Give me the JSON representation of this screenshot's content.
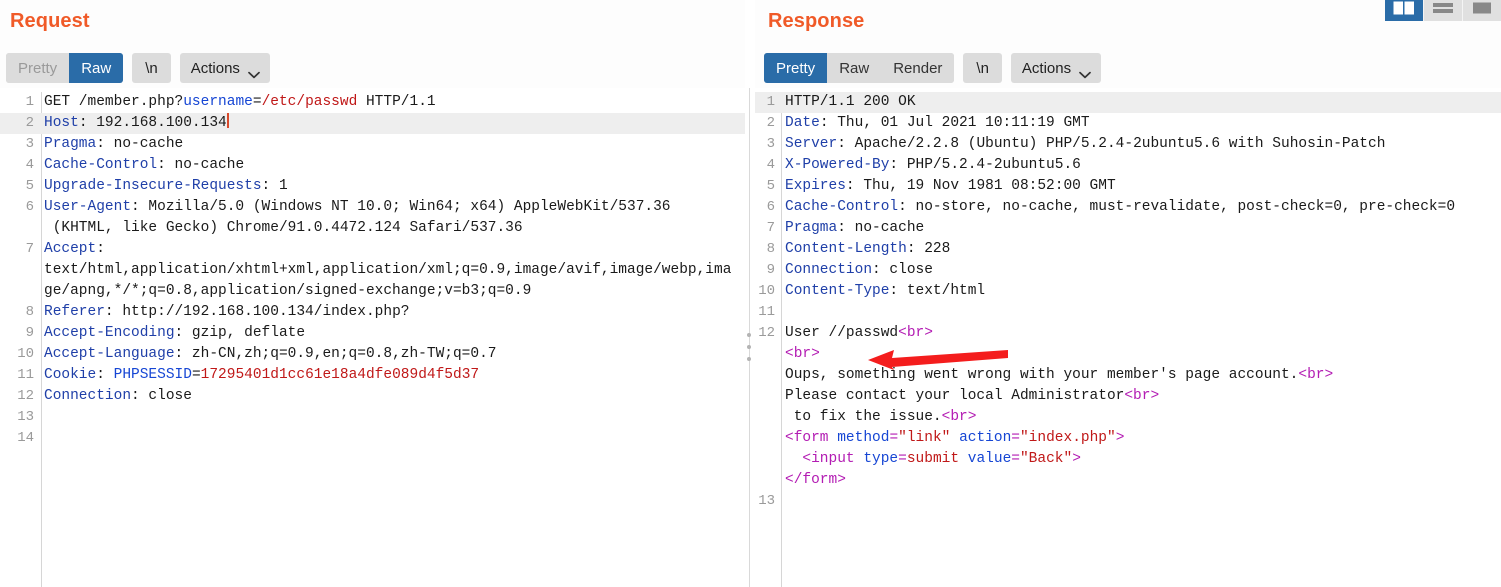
{
  "layout_toggles": [
    {
      "name": "side-by-side-layout",
      "label": "",
      "active": true
    },
    {
      "name": "stacked-layout",
      "label": "",
      "active": false
    },
    {
      "name": "single-pane-layout",
      "label": "",
      "active": false
    }
  ],
  "request": {
    "title": "Request",
    "toolbar": {
      "pretty": "Pretty",
      "raw": "Raw",
      "newline": "\\n",
      "actions": "Actions",
      "active_view": "Raw"
    },
    "lines": [
      {
        "n": "1",
        "highlight": false,
        "segs": [
          {
            "t": "GET /member.php?",
            "c": "k-txt"
          },
          {
            "t": "username",
            "c": "k-key"
          },
          {
            "t": "=",
            "c": "k-txt"
          },
          {
            "t": "/etc/passwd",
            "c": "k-val"
          },
          {
            "t": " HTTP/1.1",
            "c": "k-txt"
          }
        ]
      },
      {
        "n": "2",
        "highlight": true,
        "caret": true,
        "segs": [
          {
            "t": "Host",
            "c": "k-hdr"
          },
          {
            "t": ": 192.168.100.134",
            "c": "k-txt"
          }
        ]
      },
      {
        "n": "3",
        "highlight": false,
        "segs": [
          {
            "t": "Pragma",
            "c": "k-hdr"
          },
          {
            "t": ": no-cache",
            "c": "k-txt"
          }
        ]
      },
      {
        "n": "4",
        "highlight": false,
        "segs": [
          {
            "t": "Cache-Control",
            "c": "k-hdr"
          },
          {
            "t": ": no-cache",
            "c": "k-txt"
          }
        ]
      },
      {
        "n": "5",
        "highlight": false,
        "segs": [
          {
            "t": "Upgrade-Insecure-Requests",
            "c": "k-hdr"
          },
          {
            "t": ": 1",
            "c": "k-txt"
          }
        ]
      },
      {
        "n": "6",
        "highlight": false,
        "segs": [
          {
            "t": "User-Agent",
            "c": "k-hdr"
          },
          {
            "t": ": Mozilla/5.0 (Windows NT 10.0; Win64; x64) AppleWebKit/537.36",
            "c": "k-txt"
          }
        ]
      },
      {
        "n": "",
        "highlight": false,
        "segs": [
          {
            "t": " (KHTML, like Gecko) Chrome/91.0.4472.124 Safari/537.36",
            "c": "k-txt"
          }
        ]
      },
      {
        "n": "7",
        "highlight": false,
        "segs": [
          {
            "t": "Accept",
            "c": "k-hdr"
          },
          {
            "t": ":",
            "c": "k-txt"
          }
        ]
      },
      {
        "n": "",
        "highlight": false,
        "segs": [
          {
            "t": "text/html,application/xhtml+xml,application/xml;q=0.9,image/avif,image/webp,ima",
            "c": "k-txt"
          }
        ]
      },
      {
        "n": "",
        "highlight": false,
        "segs": [
          {
            "t": "ge/apng,*/*;q=0.8,application/signed-exchange;v=b3;q=0.9",
            "c": "k-txt"
          }
        ]
      },
      {
        "n": "8",
        "highlight": false,
        "segs": [
          {
            "t": "Referer",
            "c": "k-hdr"
          },
          {
            "t": ": http://192.168.100.134/index.php?",
            "c": "k-txt"
          }
        ]
      },
      {
        "n": "9",
        "highlight": false,
        "segs": [
          {
            "t": "Accept-Encoding",
            "c": "k-hdr"
          },
          {
            "t": ": gzip, deflate",
            "c": "k-txt"
          }
        ]
      },
      {
        "n": "10",
        "highlight": false,
        "segs": [
          {
            "t": "Accept-Language",
            "c": "k-hdr"
          },
          {
            "t": ": zh-CN,zh;q=0.9,en;q=0.8,zh-TW;q=0.7",
            "c": "k-txt"
          }
        ]
      },
      {
        "n": "11",
        "highlight": false,
        "segs": [
          {
            "t": "Cookie",
            "c": "k-hdr"
          },
          {
            "t": ": ",
            "c": "k-txt"
          },
          {
            "t": "PHPSESSID",
            "c": "k-key"
          },
          {
            "t": "=",
            "c": "k-txt"
          },
          {
            "t": "17295401d1cc61e18a4dfe089d4f5d37",
            "c": "k-val"
          }
        ]
      },
      {
        "n": "12",
        "highlight": false,
        "segs": [
          {
            "t": "Connection",
            "c": "k-hdr"
          },
          {
            "t": ": close",
            "c": "k-txt"
          }
        ]
      },
      {
        "n": "13",
        "highlight": false,
        "segs": []
      },
      {
        "n": "14",
        "highlight": false,
        "segs": []
      }
    ]
  },
  "response": {
    "title": "Response",
    "toolbar": {
      "pretty": "Pretty",
      "raw": "Raw",
      "render": "Render",
      "newline": "\\n",
      "actions": "Actions",
      "active_view": "Pretty"
    },
    "lines": [
      {
        "n": "1",
        "highlight": true,
        "segs": [
          {
            "t": "HTTP/1.1 200 OK",
            "c": "k-txt"
          }
        ]
      },
      {
        "n": "2",
        "highlight": false,
        "segs": [
          {
            "t": "Date",
            "c": "k-hdr"
          },
          {
            "t": ": Thu, 01 Jul 2021 10:11:19 GMT",
            "c": "k-txt"
          }
        ]
      },
      {
        "n": "3",
        "highlight": false,
        "segs": [
          {
            "t": "Server",
            "c": "k-hdr"
          },
          {
            "t": ": Apache/2.2.8 (Ubuntu) PHP/5.2.4-2ubuntu5.6 with Suhosin-Patch",
            "c": "k-txt"
          }
        ]
      },
      {
        "n": "4",
        "highlight": false,
        "segs": [
          {
            "t": "X-Powered-By",
            "c": "k-hdr"
          },
          {
            "t": ": PHP/5.2.4-2ubuntu5.6",
            "c": "k-txt"
          }
        ]
      },
      {
        "n": "5",
        "highlight": false,
        "segs": [
          {
            "t": "Expires",
            "c": "k-hdr"
          },
          {
            "t": ": Thu, 19 Nov 1981 08:52:00 GMT",
            "c": "k-txt"
          }
        ]
      },
      {
        "n": "6",
        "highlight": false,
        "segs": [
          {
            "t": "Cache-Control",
            "c": "k-hdr"
          },
          {
            "t": ": no-store, no-cache, must-revalidate, post-check=0, pre-check=0",
            "c": "k-txt"
          }
        ]
      },
      {
        "n": "7",
        "highlight": false,
        "segs": [
          {
            "t": "Pragma",
            "c": "k-hdr"
          },
          {
            "t": ": no-cache",
            "c": "k-txt"
          }
        ]
      },
      {
        "n": "8",
        "highlight": false,
        "segs": [
          {
            "t": "Content-Length",
            "c": "k-hdr"
          },
          {
            "t": ": 228",
            "c": "k-txt"
          }
        ]
      },
      {
        "n": "9",
        "highlight": false,
        "segs": [
          {
            "t": "Connection",
            "c": "k-hdr"
          },
          {
            "t": ": close",
            "c": "k-txt"
          }
        ]
      },
      {
        "n": "10",
        "highlight": false,
        "segs": [
          {
            "t": "Content-Type",
            "c": "k-hdr"
          },
          {
            "t": ": text/html",
            "c": "k-txt"
          }
        ]
      },
      {
        "n": "11",
        "highlight": false,
        "segs": []
      },
      {
        "n": "12",
        "highlight": false,
        "segs": [
          {
            "t": "User //passwd",
            "c": "k-txt"
          },
          {
            "t": "<br>",
            "c": "k-tag"
          }
        ]
      },
      {
        "n": "",
        "highlight": false,
        "segs": [
          {
            "t": "<br>",
            "c": "k-tag"
          }
        ]
      },
      {
        "n": "",
        "highlight": false,
        "segs": [
          {
            "t": "Oups, something went wrong with your member's page account.",
            "c": "k-txt"
          },
          {
            "t": "<br>",
            "c": "k-tag"
          }
        ]
      },
      {
        "n": "",
        "highlight": false,
        "segs": [
          {
            "t": "Please contact your local Administrator",
            "c": "k-txt"
          },
          {
            "t": "<br>",
            "c": "k-tag"
          }
        ]
      },
      {
        "n": "",
        "highlight": false,
        "segs": [
          {
            "t": " to fix the issue.",
            "c": "k-txt"
          },
          {
            "t": "<br>",
            "c": "k-tag"
          }
        ]
      },
      {
        "n": "",
        "highlight": false,
        "segs": [
          {
            "t": "<form ",
            "c": "k-tag"
          },
          {
            "t": "method",
            "c": "k-attr"
          },
          {
            "t": "=",
            "c": "k-tag"
          },
          {
            "t": "\"link\"",
            "c": "k-astr"
          },
          {
            "t": " ",
            "c": "k-tag"
          },
          {
            "t": "action",
            "c": "k-attr"
          },
          {
            "t": "=",
            "c": "k-tag"
          },
          {
            "t": "\"index.php\"",
            "c": "k-astr"
          },
          {
            "t": ">",
            "c": "k-tag"
          }
        ]
      },
      {
        "n": "",
        "highlight": false,
        "segs": [
          {
            "t": "  <input ",
            "c": "k-tag"
          },
          {
            "t": "type",
            "c": "k-attr"
          },
          {
            "t": "=",
            "c": "k-tag"
          },
          {
            "t": "submit",
            "c": "k-astr"
          },
          {
            "t": " ",
            "c": "k-tag"
          },
          {
            "t": "value",
            "c": "k-attr"
          },
          {
            "t": "=",
            "c": "k-tag"
          },
          {
            "t": "\"Back\"",
            "c": "k-astr"
          },
          {
            "t": ">",
            "c": "k-tag"
          }
        ]
      },
      {
        "n": "",
        "highlight": false,
        "segs": [
          {
            "t": "</form>",
            "c": "k-tag"
          }
        ]
      },
      {
        "n": "13",
        "highlight": false,
        "segs": []
      }
    ]
  },
  "annotation": {
    "arrow_color": "#f41d1d",
    "points_to": "User //passwd"
  },
  "colors": {
    "title": "#f05a28",
    "active_tab_bg": "#2a6ca8",
    "header_blue": "#1f3fa8",
    "value_red": "#c01818",
    "tag_magenta": "#b31cb3"
  }
}
